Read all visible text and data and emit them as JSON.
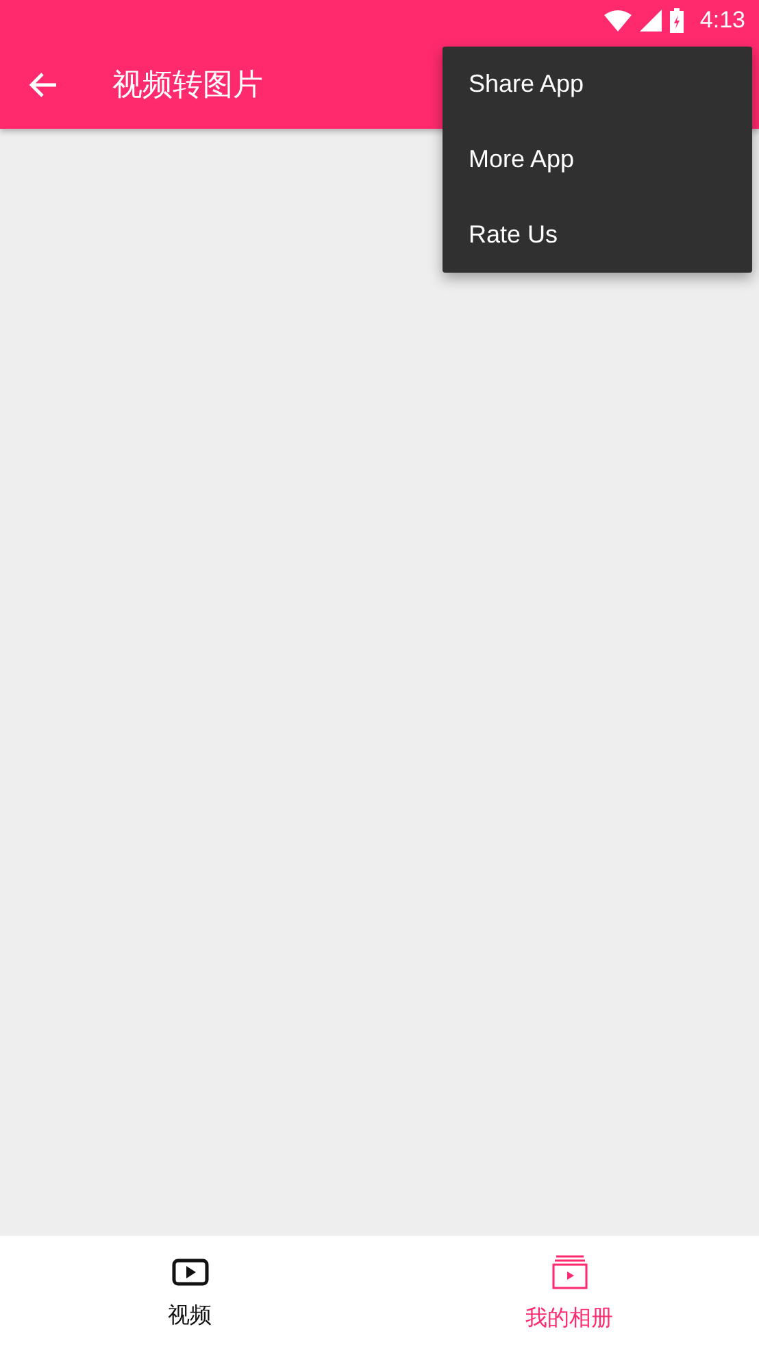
{
  "status_bar": {
    "time": "4:13"
  },
  "toolbar": {
    "title": "视频转图片"
  },
  "menu": {
    "items": [
      "Share App",
      "More App",
      "Rate Us"
    ]
  },
  "bottom_nav": [
    {
      "label": "视频",
      "kind": "video",
      "selected": false
    },
    {
      "label": "我的相册",
      "kind": "album",
      "selected": true
    }
  ]
}
